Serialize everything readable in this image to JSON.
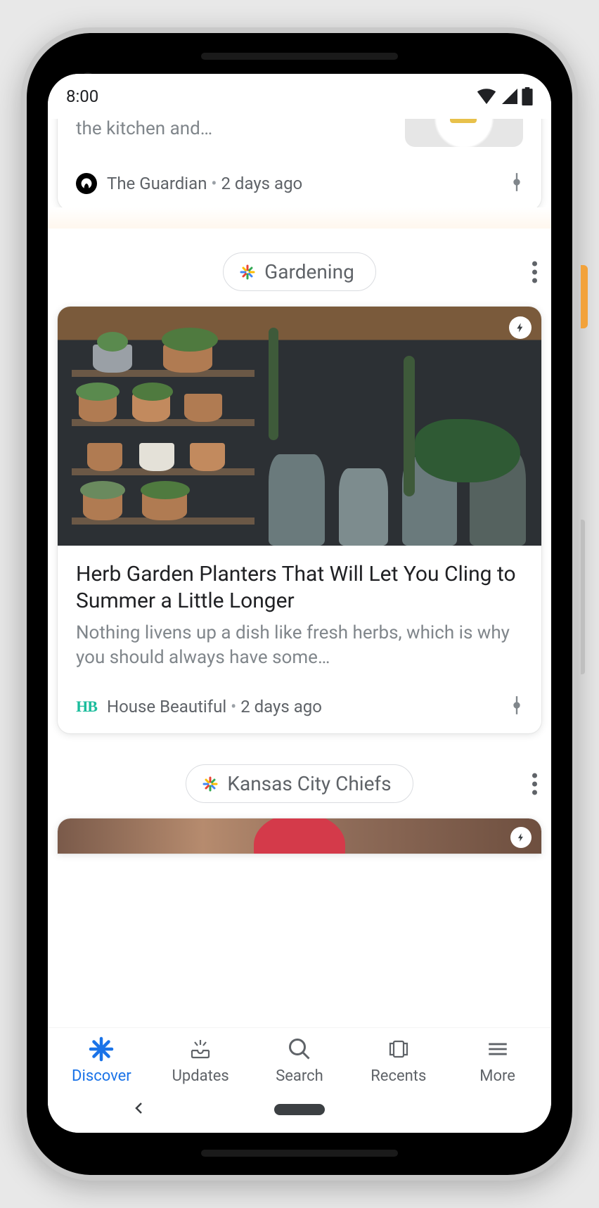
{
  "status_bar": {
    "time": "8:00"
  },
  "feed": {
    "partial_top_card": {
      "snippet": "The River Cafe chef on his mentors in the kitchen and…",
      "publisher": "The Guardian",
      "age": "2 days ago"
    },
    "topics": [
      {
        "chip_label": "Gardening",
        "card": {
          "title": "Herb Garden Planters That Will Let You Cling to Summer a Little Longer",
          "snippet": "Nothing livens up a dish like fresh herbs, which is why you should always have some…",
          "publisher": "House Beautiful",
          "publisher_abbrev": "HB",
          "age": "2 days ago"
        }
      },
      {
        "chip_label": "Kansas City Chiefs"
      }
    ]
  },
  "bottom_nav": {
    "items": [
      {
        "label": "Discover",
        "icon": "spark",
        "active": true
      },
      {
        "label": "Updates",
        "icon": "inbox"
      },
      {
        "label": "Search",
        "icon": "search"
      },
      {
        "label": "Recents",
        "icon": "recents"
      },
      {
        "label": "More",
        "icon": "menu"
      }
    ]
  }
}
